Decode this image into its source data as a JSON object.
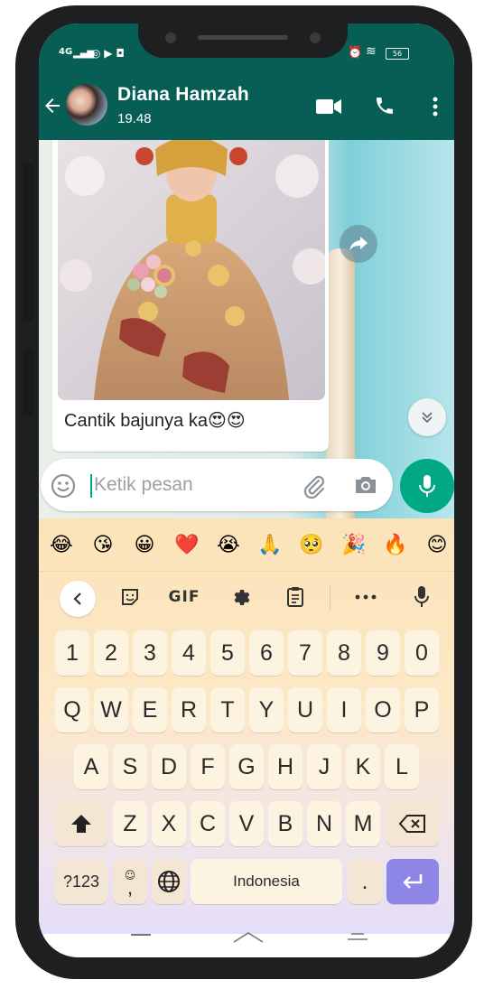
{
  "status": {
    "network": "4G",
    "battery": "56"
  },
  "header": {
    "contact_name": "Diana Hamzah",
    "subtitle": "19.48"
  },
  "message": {
    "text": "Cantik bajunya ka",
    "emojis": "😍😍"
  },
  "input": {
    "placeholder": "Ketik pesan"
  },
  "emoji_suggestions": [
    "😂",
    "😘",
    "😀",
    "❤️",
    "😭",
    "🙏",
    "🥺",
    "🎉",
    "🔥",
    "😊"
  ],
  "toolbar": {
    "gif_label": "GIF"
  },
  "keyboard": {
    "number_row": [
      "1",
      "2",
      "3",
      "4",
      "5",
      "6",
      "7",
      "8",
      "9",
      "0"
    ],
    "row1": [
      "Q",
      "W",
      "E",
      "R",
      "T",
      "Y",
      "U",
      "I",
      "O",
      "P"
    ],
    "row2": [
      "A",
      "S",
      "D",
      "F",
      "G",
      "H",
      "J",
      "K",
      "L"
    ],
    "row3": [
      "Z",
      "X",
      "C",
      "V",
      "B",
      "N",
      "M"
    ],
    "symbols_label": "?123",
    "comma_label": ",",
    "space_label": "Indonesia",
    "period_label": "."
  },
  "colors": {
    "brand": "#075e54",
    "accent": "#00a884",
    "enter_key": "#8e86e6"
  }
}
